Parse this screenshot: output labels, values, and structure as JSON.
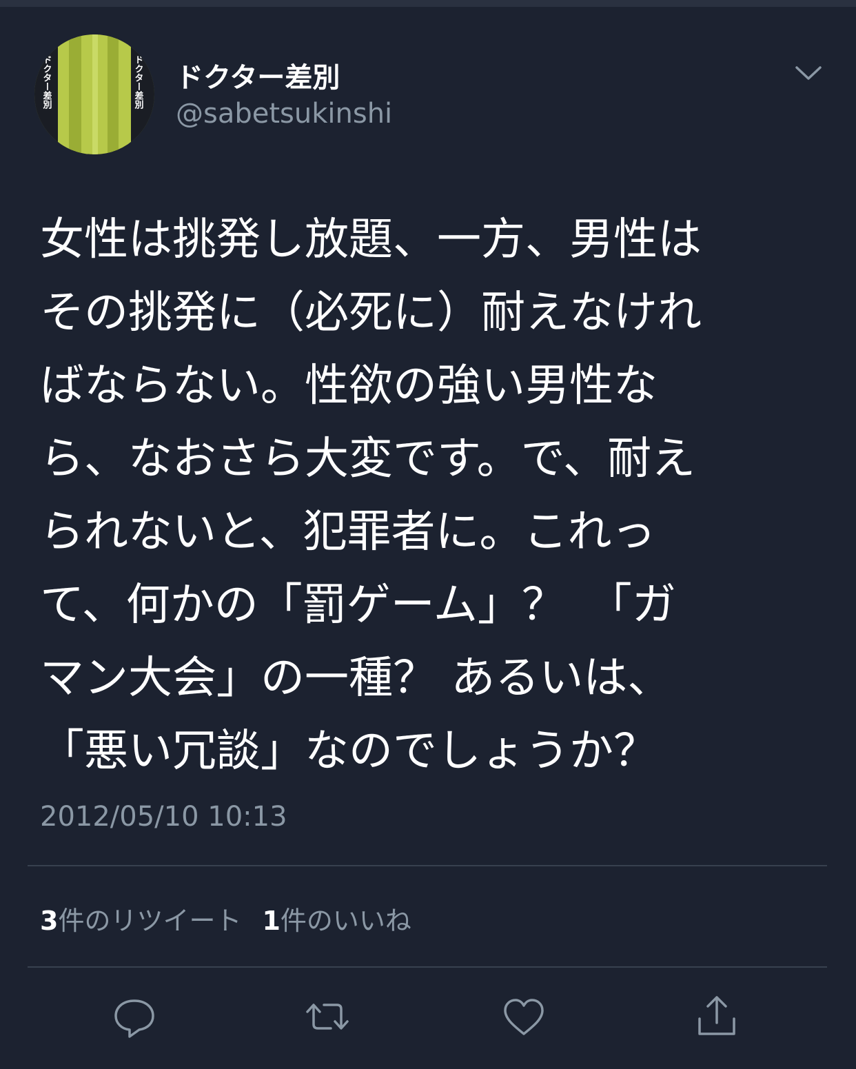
{
  "tweet": {
    "author": {
      "display_name": "ドクター差別",
      "handle": "@sabetsukinshi",
      "avatar_text_left": "ドクター差別",
      "avatar_text_right": "ドクター差別"
    },
    "text_lines": [
      "女性は挑発し放題、一方、男性は",
      "その挑発に（必死に）耐えなけれ",
      "ばならない。性欲の強い男性な",
      "ら、なおさら大変です。で、耐え",
      "られないと、犯罪者に。これっ",
      "て、何かの「罰ゲーム」？　「ガ",
      "マン大会」の一種？ あるいは、",
      "「悪い冗談」なのでしょうか？"
    ],
    "timestamp": "2012/05/10 10:13",
    "stats": {
      "retweets_count": "3",
      "retweets_label": "件のリツイート",
      "likes_count": "1",
      "likes_label": "件のいいね"
    }
  },
  "icons": {
    "menu": "chevron-down-icon",
    "reply": "reply-icon",
    "retweet": "retweet-icon",
    "like": "heart-icon",
    "share": "share-icon"
  },
  "colors": {
    "background": "#1c2230",
    "text": "#ffffff",
    "secondary_text": "#8b98a5",
    "divider": "#38414f"
  }
}
